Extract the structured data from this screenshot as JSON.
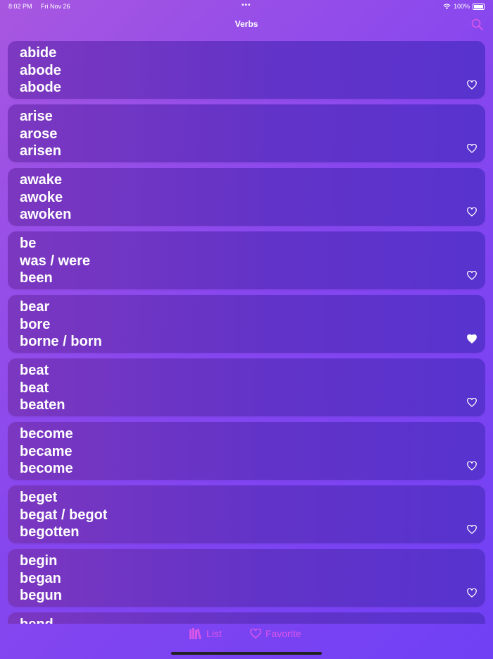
{
  "status_bar": {
    "time": "8:02 PM",
    "date": "Fri Nov 26",
    "dots": "•••",
    "battery": "100%"
  },
  "nav": {
    "title": "Verbs"
  },
  "verbs": [
    {
      "forms": [
        "abide",
        "abode",
        "abode"
      ],
      "favorite": false
    },
    {
      "forms": [
        "arise",
        "arose",
        "arisen"
      ],
      "favorite": false
    },
    {
      "forms": [
        "awake",
        "awoke",
        "awoken"
      ],
      "favorite": false
    },
    {
      "forms": [
        "be",
        "was / were",
        "been"
      ],
      "favorite": false
    },
    {
      "forms": [
        "bear",
        "bore",
        "borne / born"
      ],
      "favorite": true
    },
    {
      "forms": [
        "beat",
        "beat",
        "beaten"
      ],
      "favorite": false
    },
    {
      "forms": [
        "become",
        "became",
        "become"
      ],
      "favorite": false
    },
    {
      "forms": [
        "beget",
        "begat / begot",
        "begotten"
      ],
      "favorite": false
    },
    {
      "forms": [
        "begin",
        "began",
        "begun"
      ],
      "favorite": false
    },
    {
      "forms": [
        "bend",
        "",
        ""
      ],
      "favorite": false
    }
  ],
  "tabs": {
    "list_label": "List",
    "favorite_label": "Favorite"
  },
  "colors": {
    "accent": "#d957e8"
  }
}
